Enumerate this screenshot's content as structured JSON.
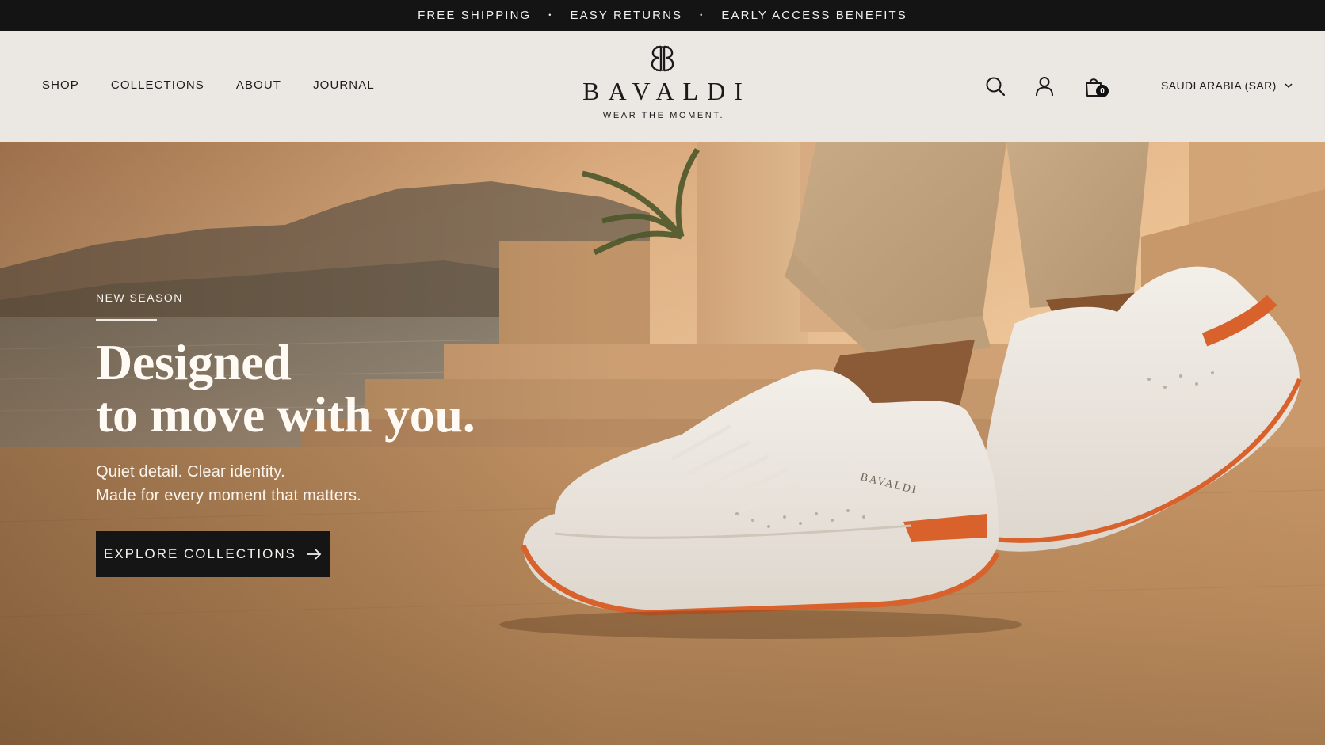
{
  "announcement": {
    "items": [
      "FREE SHIPPING",
      "EASY RETURNS",
      "EARLY ACCESS BENEFITS"
    ],
    "separator": "•"
  },
  "nav": {
    "items": [
      "SHOP",
      "COLLECTIONS",
      "ABOUT",
      "JOURNAL"
    ]
  },
  "brand": {
    "monogram": "BB",
    "name": "BAVALDI",
    "tagline": "WEAR THE MOMENT."
  },
  "utilities": {
    "icons": [
      "search-icon",
      "account-icon",
      "bag-icon"
    ],
    "cart_count": "0",
    "region": "SAUDI ARABIA (SAR)"
  },
  "hero": {
    "eyebrow": "NEW SEASON",
    "headline_line1": "Designed",
    "headline_line2": "to move with you.",
    "sub_line1": "Quiet detail. Clear identity.",
    "sub_line2": "Made for every moment that matters.",
    "cta_label": "EXPLORE COLLECTIONS",
    "shoe_brand_text": "BAVALDI"
  },
  "colors": {
    "announcement_bg": "#141414",
    "header_bg": "#ebe7e3",
    "cta_bg": "#151515",
    "sole_accent": "#d9622c"
  }
}
